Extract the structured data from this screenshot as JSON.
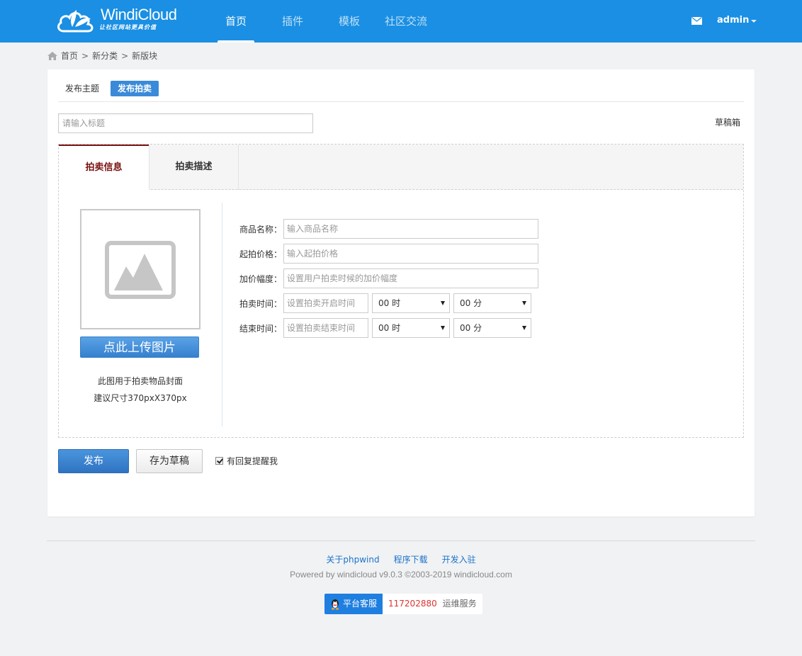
{
  "brand": {
    "name": "WindiCloud",
    "tagline": "让社区网站更具价值"
  },
  "nav": {
    "items": [
      "首页",
      "插件",
      "模板",
      "社区交流"
    ],
    "active": 0
  },
  "user": {
    "name": "admin"
  },
  "breadcrumb": {
    "home": "首页",
    "category": "新分类",
    "board": "新版块",
    "separator": ">"
  },
  "post_types": {
    "items": [
      "发布主题",
      "发布拍卖"
    ],
    "active": 1
  },
  "title_input": {
    "placeholder": "请输入标题",
    "value": ""
  },
  "draft_box_label": "草稿箱",
  "editor_tabs": {
    "items": [
      "拍卖信息",
      "拍卖描述"
    ],
    "active": 0
  },
  "upload": {
    "button_label": "点此上传图片",
    "note1": "此图用于拍卖物品封面",
    "note2": "建议尺寸370pxX370px"
  },
  "form": {
    "product_name": {
      "label": "商品名称：",
      "placeholder": "输入商品名称"
    },
    "start_price": {
      "label": "起拍价格：",
      "placeholder": "输入起拍价格"
    },
    "increment": {
      "label": "加价幅度：",
      "placeholder": "设置用户拍卖时候的加价幅度"
    },
    "start_time": {
      "label": "拍卖时间：",
      "placeholder": "设置拍卖开启时间",
      "hour": "00 时",
      "minute": "00 分"
    },
    "end_time": {
      "label": "结束时间：",
      "placeholder": "设置拍卖结束时间",
      "hour": "00 时",
      "minute": "00 分"
    }
  },
  "actions": {
    "publish": "发布",
    "save_draft": "存为草稿",
    "remind_label": "有回复提醒我",
    "remind_checked": true
  },
  "footer": {
    "links": [
      "关于phpwind",
      "程序下载",
      "开发入驻"
    ],
    "powered": "Powered by windicloud v9.0.3 ©2003-2019 windicloud.com",
    "service_label": "平台客服",
    "service_number": "117202880",
    "service_text": "运维服务"
  },
  "colors": {
    "header": "#1a8fe3",
    "accent": "#3a8ad9",
    "active_tab": "#7a1212"
  }
}
